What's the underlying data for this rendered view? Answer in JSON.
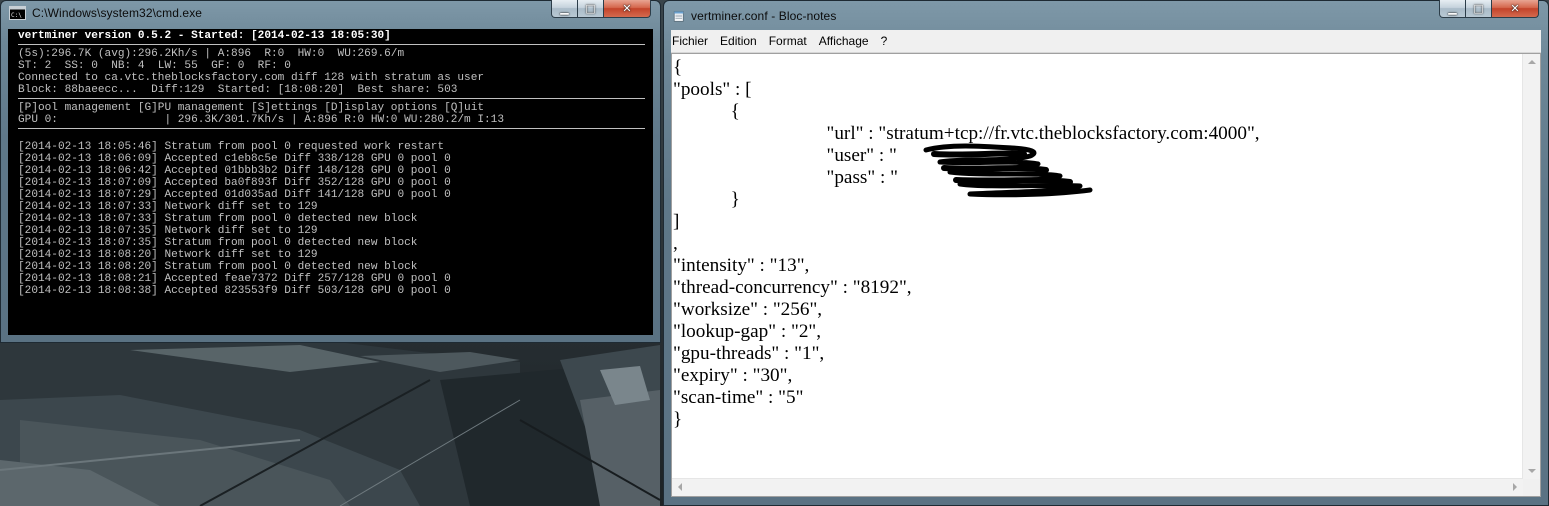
{
  "colors": {
    "console_bg": "#000000",
    "console_fg": "#c0c0c0",
    "window_frame": "#6d8797",
    "close_button": "#c3432a",
    "notepad_bg": "#ffffff"
  },
  "caption_buttons": {
    "minimize_icon": "minimize-icon",
    "maximize_icon": "maximize-icon",
    "close_icon": "close-icon"
  },
  "cmd_window": {
    "title": "C:\\Windows\\system32\\cmd.exe",
    "header": "vertminer version 0.5.2 - Started: [2014-02-13 18:05:30]",
    "status_lines": [
      "(5s):296.7K (avg):296.2Kh/s | A:896  R:0  HW:0  WU:269.6/m",
      "ST: 2  SS: 0  NB: 4  LW: 55  GF: 0  RF: 0",
      "Connected to ca.vtc.theblocksfactory.com diff 128 with stratum as user",
      "Block: 88baeecc...  Diff:129  Started: [18:08:20]  Best share: 503"
    ],
    "menu_line": "[P]ool management [G]PU management [S]ettings [D]isplay options [Q]uit",
    "gpu_line": "GPU 0:                | 296.3K/301.7Kh/s | A:896 R:0 HW:0 WU:280.2/m I:13",
    "log_lines": [
      "[2014-02-13 18:05:46] Stratum from pool 0 requested work restart",
      "[2014-02-13 18:06:09] Accepted c1eb8c5e Diff 338/128 GPU 0 pool 0",
      "[2014-02-13 18:06:42] Accepted 01bbb3b2 Diff 148/128 GPU 0 pool 0",
      "[2014-02-13 18:07:09] Accepted ba0f893f Diff 352/128 GPU 0 pool 0",
      "[2014-02-13 18:07:29] Accepted 01d035ad Diff 141/128 GPU 0 pool 0",
      "[2014-02-13 18:07:33] Network diff set to 129",
      "[2014-02-13 18:07:33] Stratum from pool 0 detected new block",
      "[2014-02-13 18:07:35] Network diff set to 129",
      "[2014-02-13 18:07:35] Stratum from pool 0 detected new block",
      "[2014-02-13 18:08:20] Network diff set to 129",
      "[2014-02-13 18:08:20] Stratum from pool 0 detected new block",
      "[2014-02-13 18:08:21] Accepted feae7372 Diff 257/128 GPU 0 pool 0",
      "[2014-02-13 18:08:38] Accepted 823553f9 Diff 503/128 GPU 0 pool 0"
    ]
  },
  "notepad_window": {
    "title": "vertminer.conf - Bloc-notes",
    "menu": [
      "Fichier",
      "Edition",
      "Format",
      "Affichage",
      "?"
    ],
    "lines": [
      "{",
      "\"pools\" : [",
      "            {",
      "                                \"url\" : \"stratum+tcp://fr.vtc.theblocksfactory.com:4000\",",
      "                                \"user\" : \"",
      "                                \"pass\" : \"",
      "            }",
      "]",
      ",",
      "\"intensity\" : \"13\",",
      "\"thread-concurrency\" : \"8192\",",
      "\"worksize\" : \"256\",",
      "\"lookup-gap\" : \"2\",",
      "\"gpu-threads\" : \"1\",",
      "\"expiry\" : \"30\",",
      "\"scan-time\" : \"5\"",
      "}"
    ]
  }
}
